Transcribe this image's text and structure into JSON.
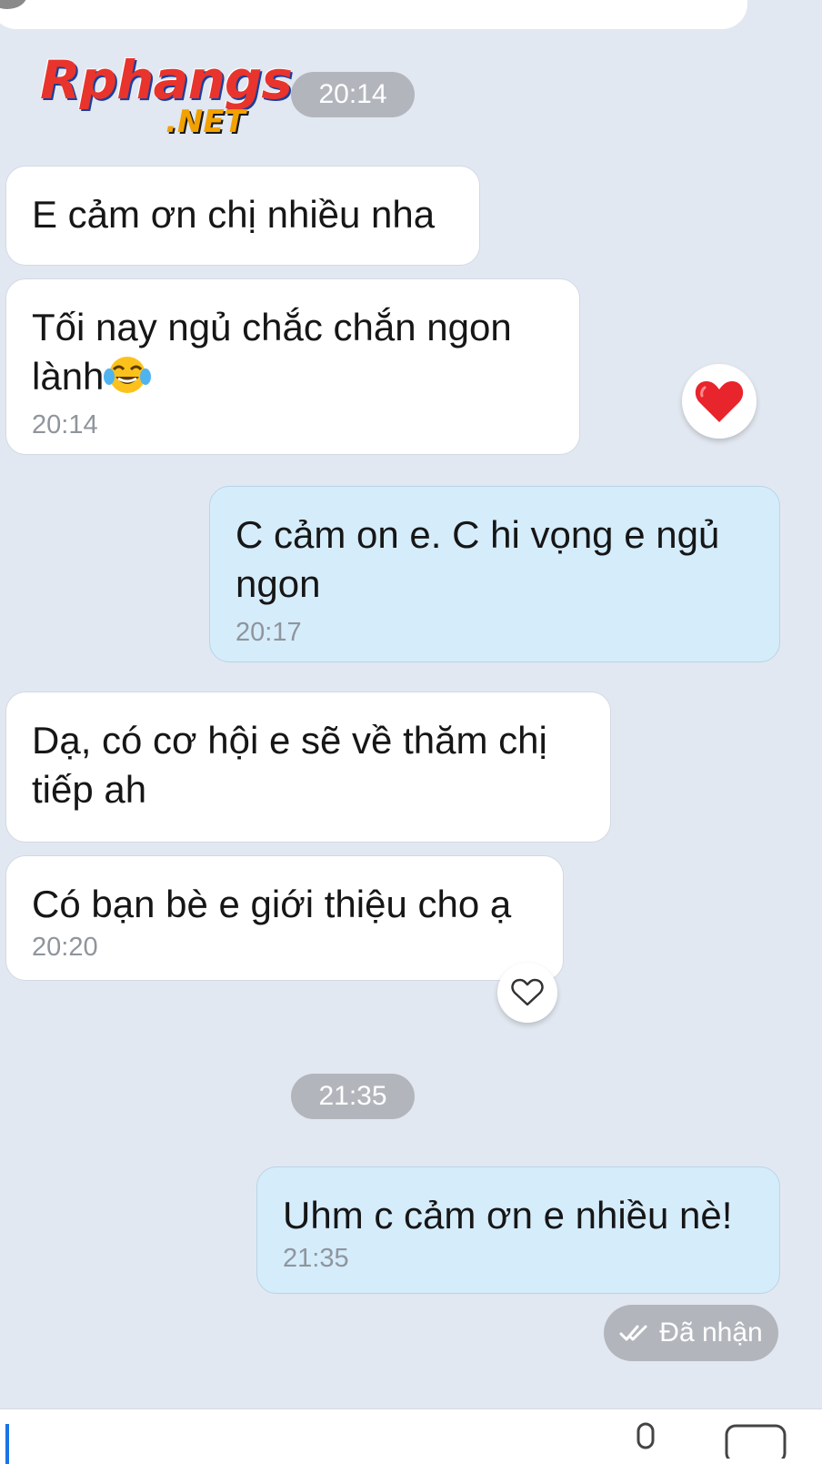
{
  "watermark": {
    "brand": "Rphangs",
    "domain": ".NET"
  },
  "timestamps": {
    "pill_1": "20:14",
    "pill_2": "21:35"
  },
  "messages": [
    {
      "side": "in",
      "text": "E cảm ơn chị nhiều nha",
      "time": ""
    },
    {
      "side": "in",
      "text": "Tối nay ngủ chắc chắn ngon\nlành",
      "emoji": "tears-of-joy-emoji",
      "time": "20:14",
      "reaction": "red-heart"
    },
    {
      "side": "out",
      "text": "C cảm on e. C hi vọng e ngủ\nngon",
      "time": "20:17"
    },
    {
      "side": "in",
      "text": "Dạ, có cơ hội e sẽ về thăm chị\ntiếp ah",
      "time": ""
    },
    {
      "side": "in",
      "text": "Có bạn bè e giới thiệu cho ạ",
      "time": "20:20",
      "reaction": "heart-outline"
    },
    {
      "side": "out",
      "text": "Uhm c cảm ơn e nhiều nè!",
      "time": "21:35"
    }
  ],
  "status": {
    "received_label": "Đã nhận",
    "icon": "double-check-icon"
  },
  "colors": {
    "background": "#e2e8f1",
    "incoming_bubble": "#ffffff",
    "outgoing_bubble": "#d5ecfb",
    "pill": "#b2b6bc",
    "heart": "#e8242c",
    "cursor": "#1a73e8"
  }
}
